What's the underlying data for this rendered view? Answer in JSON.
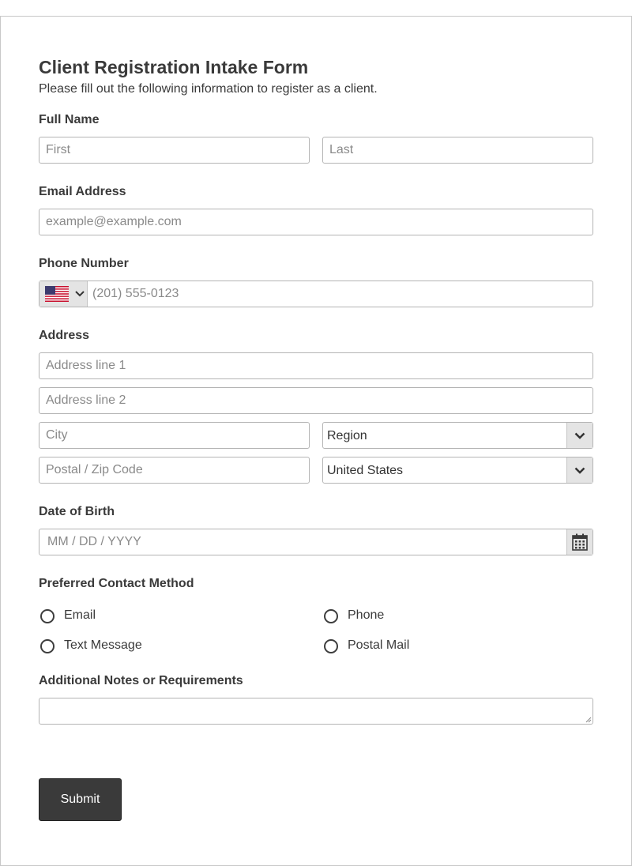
{
  "form": {
    "title": "Client Registration Intake Form",
    "subtitle": "Please fill out the following information to register as a client."
  },
  "full_name": {
    "label": "Full Name",
    "first_placeholder": "First",
    "last_placeholder": "Last"
  },
  "email": {
    "label": "Email Address",
    "placeholder": "example@example.com"
  },
  "phone": {
    "label": "Phone Number",
    "country_flag_icon": "us-flag-icon",
    "placeholder": "(201) 555-0123"
  },
  "address": {
    "label": "Address",
    "line1_placeholder": "Address line 1",
    "line2_placeholder": "Address line 2",
    "city_placeholder": "City",
    "region_value": "Region",
    "postal_placeholder": "Postal / Zip Code",
    "country_value": "United States"
  },
  "dob": {
    "label": "Date of Birth",
    "placeholder": "MM / DD / YYYY",
    "icon": "calendar-icon"
  },
  "contact_method": {
    "label": "Preferred Contact Method",
    "options": [
      "Email",
      "Phone",
      "Text Message",
      "Postal Mail"
    ]
  },
  "notes": {
    "label": "Additional Notes or Requirements"
  },
  "submit_label": "Submit",
  "colors": {
    "button_bg": "#3a3a3a",
    "border": "#b4b4b4",
    "addon_bg": "#e4e4e4",
    "text": "#3a3a3a"
  }
}
